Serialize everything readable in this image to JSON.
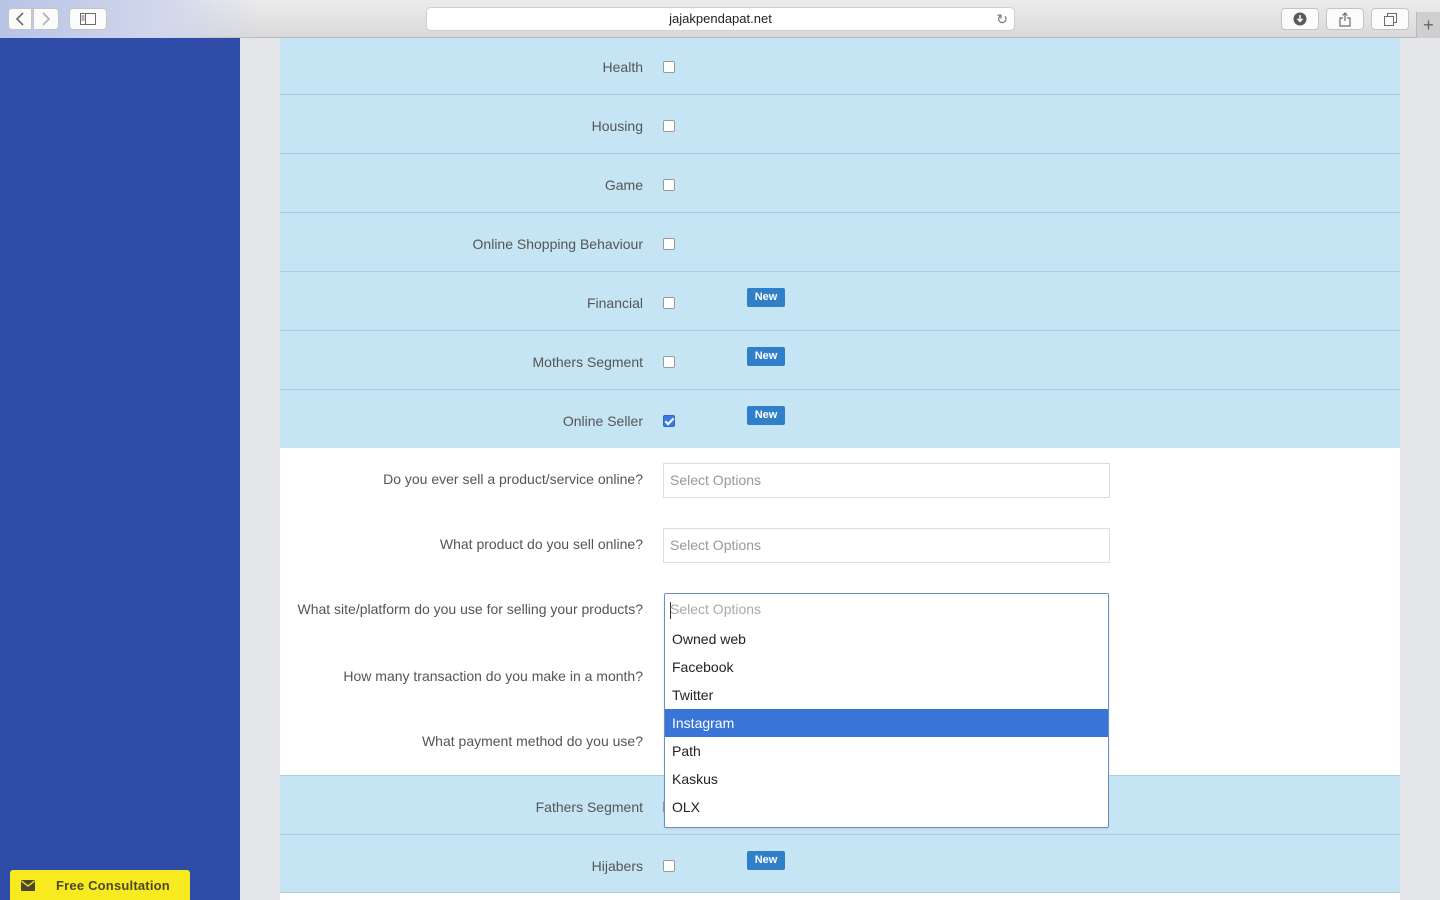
{
  "browser": {
    "url": "jajakpendapat.net"
  },
  "sidebar": {
    "consult_label": "Free Consultation"
  },
  "segments_top": [
    {
      "label": "Health",
      "checked": false,
      "new": false
    },
    {
      "label": "Housing",
      "checked": false,
      "new": false
    },
    {
      "label": "Game",
      "checked": false,
      "new": false
    },
    {
      "label": "Online Shopping Behaviour",
      "checked": false,
      "new": false
    },
    {
      "label": "Financial",
      "checked": false,
      "new": true
    },
    {
      "label": "Mothers Segment",
      "checked": false,
      "new": true
    },
    {
      "label": "Online Seller",
      "checked": true,
      "new": true
    }
  ],
  "badge_label": "New",
  "questions": [
    {
      "label": "Do you ever sell a product/service online?",
      "placeholder": "Select Options"
    },
    {
      "label": "What product do you sell online?",
      "placeholder": "Select Options"
    },
    {
      "label": "What site/platform do you use for selling your products?",
      "placeholder": "Select Options"
    },
    {
      "label": "How many transaction do you make in a month?",
      "placeholder": ""
    },
    {
      "label": "What payment method do you use?",
      "placeholder": ""
    }
  ],
  "dropdown": {
    "placeholder": "Select Options",
    "options": [
      "Owned web",
      "Facebook",
      "Twitter",
      "Instagram",
      "Path",
      "Kaskus",
      "OLX"
    ],
    "highlighted": "Instagram"
  },
  "segments_bottom": [
    {
      "label": "Fathers Segment",
      "checked": false,
      "new": false
    },
    {
      "label": "Hijabers",
      "checked": false,
      "new": true
    }
  ]
}
